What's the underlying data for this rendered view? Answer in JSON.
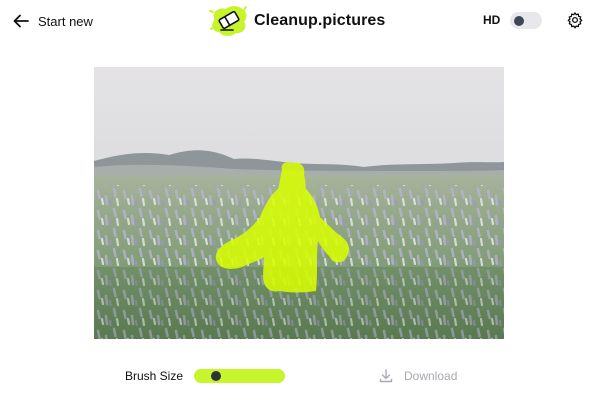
{
  "header": {
    "start_new_label": "Start new",
    "back_icon": "arrow-left-icon",
    "brand_name": "Cleanup.pictures",
    "brand_icon": "eraser-logo-icon",
    "hd_label": "HD",
    "hd_enabled": false,
    "settings_icon": "gear-icon"
  },
  "editor": {
    "image_description": "photo of person in lupine field with green brush mask"
  },
  "toolbar": {
    "brush_size_label": "Brush Size",
    "brush_size_value": 0.2,
    "download_label": "Download",
    "download_icon": "download-icon",
    "download_enabled": false
  },
  "colors": {
    "accent": "#c6f52b",
    "mask": "#d8ff00",
    "text": "#111111",
    "disabled_text": "#a8aab0"
  }
}
